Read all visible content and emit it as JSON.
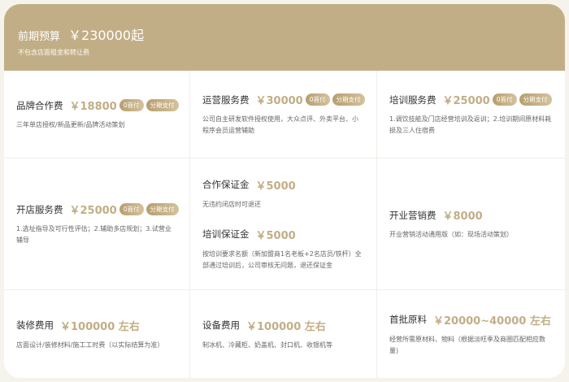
{
  "header": {
    "label": "前期预算",
    "amount": "￥230000起",
    "subtitle": "不包含店面租金和转让费"
  },
  "badges": {
    "first": "0首付",
    "installment": "分期支付"
  },
  "colors": {
    "accent": "#c2ae86",
    "header_bg": "#c2ae86",
    "page_bg": "#f5f3ec"
  },
  "cells": [
    {
      "items": [
        {
          "name": "品牌合作费",
          "price": "￥18800",
          "badges": true,
          "desc": "三年单店授权/新品更新/品牌活动策划"
        }
      ]
    },
    {
      "items": [
        {
          "name": "运营服务费",
          "price": "￥30000",
          "badges": true,
          "desc": "公司自主研发软件授权使用，大众点评、外卖平台、小程序会员运营辅助"
        }
      ]
    },
    {
      "items": [
        {
          "name": "培训服务费",
          "price": "￥25000",
          "badges": true,
          "desc": "1.调饮技能及门店经营培训及返训；2.培训期间原材料耗损及三人住宿费"
        }
      ]
    },
    {
      "items": [
        {
          "name": "开店服务费",
          "price": "￥25000",
          "badges": true,
          "desc": "1.选址指导及可行性评估；2.辅助多店规划；3.试营业辅导"
        }
      ]
    },
    {
      "items": [
        {
          "name": "合作保证金",
          "price": "￥5000",
          "badges": false,
          "desc": "无违约闭店时可退还"
        },
        {
          "name": "培训保证金",
          "price": "￥5000",
          "badges": false,
          "desc": "按培训要求名额（新加盟商1名老板+2名店员/铁杆）全部通过培训后，公司审核无问题，退还保证金"
        }
      ]
    },
    {
      "items": [
        {
          "name": "开业营销费",
          "price": "￥8000",
          "badges": false,
          "desc": "开业营销活动通用版（如：现场活动策划）"
        }
      ]
    },
    {
      "items": [
        {
          "name": "装修费用",
          "price": "￥100000 左右",
          "badges": false,
          "desc": "店面设计/装修材料/施工工时费（以实际结算为准）"
        }
      ]
    },
    {
      "items": [
        {
          "name": "设备费用",
          "price": "￥100000 左右",
          "badges": false,
          "desc": "制冰机、冷藏柜、奶盖机、封口机、收银机等"
        }
      ]
    },
    {
      "items": [
        {
          "name": "首批原料",
          "price": "￥20000~40000 左右",
          "badges": false,
          "desc": "经营所需原材料、物料（根据淡旺季及商圈匹配相应数量)"
        }
      ]
    }
  ]
}
